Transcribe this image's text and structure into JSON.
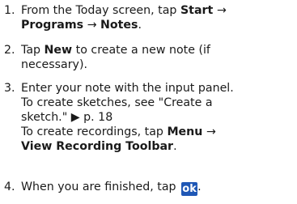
{
  "steps": [
    {
      "number": "1.",
      "line1_text": "From the Today screen, tap ",
      "line1_bold": "Start",
      "line1_arrow": " →",
      "line2_bold_a": "Programs",
      "line2_arrow": " → ",
      "line2_bold_b": "Notes",
      "line2_end": "."
    },
    {
      "number": "2.",
      "line1_prefix": "Tap ",
      "line1_bold": "New",
      "line1_text": " to create a new note (if",
      "line2_text": "necessary)."
    },
    {
      "number": "3.",
      "line1_text": "Enter your note with the input panel.",
      "line2_text": "To create sketches, see \"Create a",
      "line3_text": "sketch.\" ▶ p. 18",
      "line4_prefix": "To create recordings, tap ",
      "line4_bold": "Menu",
      "line4_arrow": " →",
      "line5_bold": "View Recording Toolbar",
      "line5_end": "."
    },
    {
      "number": "4.",
      "line1_text": "When you are finished, tap ",
      "ok_label": "ok",
      "line1_end": "."
    }
  ],
  "colors": {
    "ok_icon_bg": "#1f57b5",
    "text": "#1a1a1a"
  },
  "icons": [
    "ok-button-icon"
  ]
}
